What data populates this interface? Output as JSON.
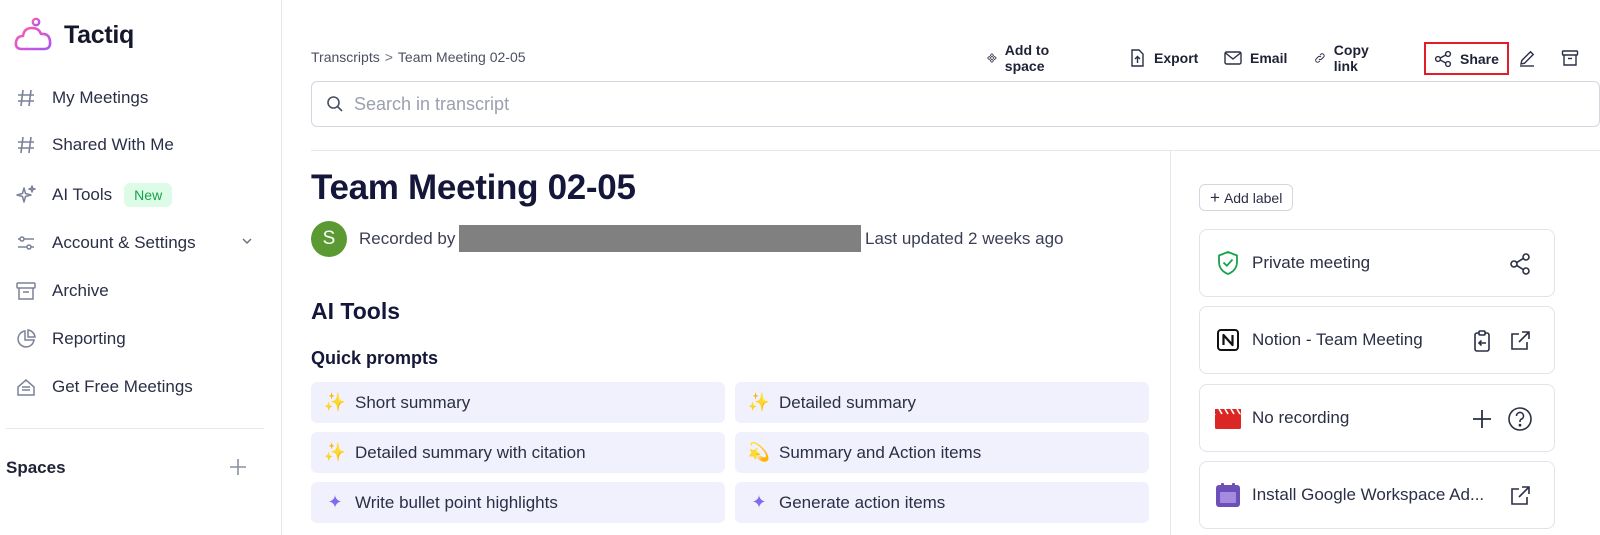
{
  "app": {
    "name": "Tactiq"
  },
  "sidebar": {
    "items": [
      {
        "label": "My Meetings",
        "icon": "hash-icon"
      },
      {
        "label": "Shared With Me",
        "icon": "hash-icon"
      },
      {
        "label": "AI Tools",
        "icon": "sparkle-icon",
        "badge": "New"
      },
      {
        "label": "Account & Settings",
        "icon": "sliders-icon"
      },
      {
        "label": "Archive",
        "icon": "archive-icon"
      },
      {
        "label": "Reporting",
        "icon": "pie-chart-icon"
      },
      {
        "label": "Get Free Meetings",
        "icon": "gift-icon"
      }
    ],
    "spaces_label": "Spaces"
  },
  "breadcrumb": {
    "root": "Transcripts",
    "separator": ">",
    "current": "Team Meeting 02-05"
  },
  "toolbar": {
    "add_to_space": "Add to space",
    "export": "Export",
    "email": "Email",
    "copy_link": "Copy link",
    "share": "Share"
  },
  "search": {
    "placeholder": "Search in transcript"
  },
  "meeting": {
    "title": "Team Meeting 02-05",
    "avatar_initial": "S",
    "recorded_by_label": "Recorded by",
    "last_updated": "Last updated 2 weeks ago"
  },
  "ai_tools": {
    "heading": "AI Tools",
    "quick_prompts_heading": "Quick prompts",
    "prompts": [
      {
        "label": "Short summary",
        "emoji": "✨"
      },
      {
        "label": "Detailed summary",
        "emoji": "✨"
      },
      {
        "label": "Detailed summary with citation",
        "emoji": "✨"
      },
      {
        "label": "Summary and Action items",
        "emoji": "💫"
      },
      {
        "label": "Write bullet point highlights",
        "emoji": "✦"
      },
      {
        "label": "Generate action items",
        "emoji": "✦"
      }
    ]
  },
  "right_panel": {
    "add_label": "Add label",
    "cards": [
      {
        "label": "Private meeting",
        "icon": "shield-check-icon"
      },
      {
        "label": "Notion - Team Meeting",
        "icon": "notion-icon"
      },
      {
        "label": "No recording",
        "icon": "clapperboard-icon"
      },
      {
        "label": "Install Google Workspace Ad...",
        "icon": "calendar-app-icon"
      }
    ]
  },
  "colors": {
    "accent_highlight": "#e11d2a",
    "badge_green_bg": "#dcfce7",
    "badge_green_text": "#16a34a",
    "prompt_bg": "#f1f1fd",
    "avatar_bg": "#5b9a32"
  }
}
